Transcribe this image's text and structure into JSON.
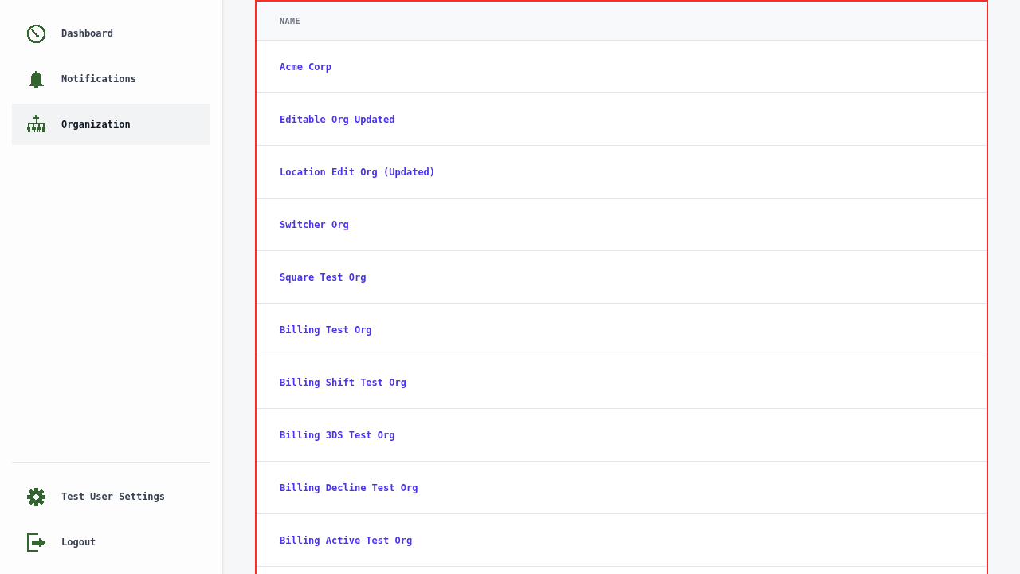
{
  "sidebar": {
    "nav_items": [
      {
        "label": "Dashboard",
        "selected": false
      },
      {
        "label": "Notifications",
        "selected": false
      },
      {
        "label": "Organization",
        "selected": true
      }
    ],
    "footer_items": [
      {
        "label": "Test User Settings",
        "selected": false
      },
      {
        "label": "Logout",
        "selected": false
      }
    ]
  },
  "table": {
    "columns": [
      "NAME"
    ],
    "rows": [
      {
        "name": "Acme Corp"
      },
      {
        "name": "Editable Org Updated"
      },
      {
        "name": "Location Edit Org (Updated)"
      },
      {
        "name": "Switcher Org"
      },
      {
        "name": "Square Test Org"
      },
      {
        "name": "Billing Test Org"
      },
      {
        "name": "Billing Shift Test Org"
      },
      {
        "name": "Billing 3DS Test Org"
      },
      {
        "name": "Billing Decline Test Org"
      },
      {
        "name": "Billing Active Test Org"
      }
    ]
  }
}
